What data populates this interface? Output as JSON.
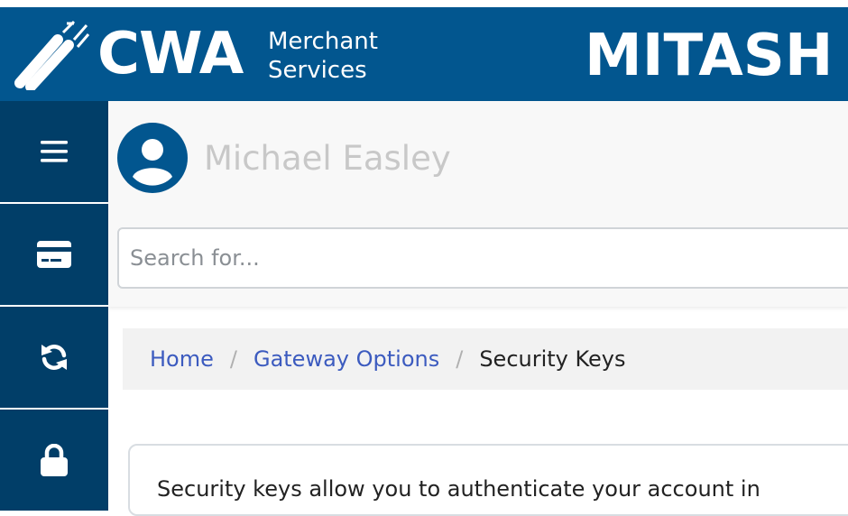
{
  "header": {
    "logo_text": "CWA",
    "logo_subtitle_line1": "Merchant",
    "logo_subtitle_line2": "Services",
    "brand_right": "MITASH"
  },
  "sidebar": {
    "items": [
      {
        "icon": "menu-icon"
      },
      {
        "icon": "credit-card-icon"
      },
      {
        "icon": "refresh-icon"
      },
      {
        "icon": "lock-icon"
      }
    ]
  },
  "user": {
    "name": "Michael Easley",
    "avatar_icon": "user-circle-icon"
  },
  "search": {
    "placeholder": "Search for...",
    "value": ""
  },
  "breadcrumb": {
    "home": "Home",
    "gateway_options": "Gateway Options",
    "current": "Security Keys",
    "separator": "/"
  },
  "card": {
    "text": "Security keys allow you to authenticate your account in"
  },
  "colors": {
    "header_bg": "#02568f",
    "sidebar_bg": "#013e68",
    "link": "#3c5bbf"
  }
}
